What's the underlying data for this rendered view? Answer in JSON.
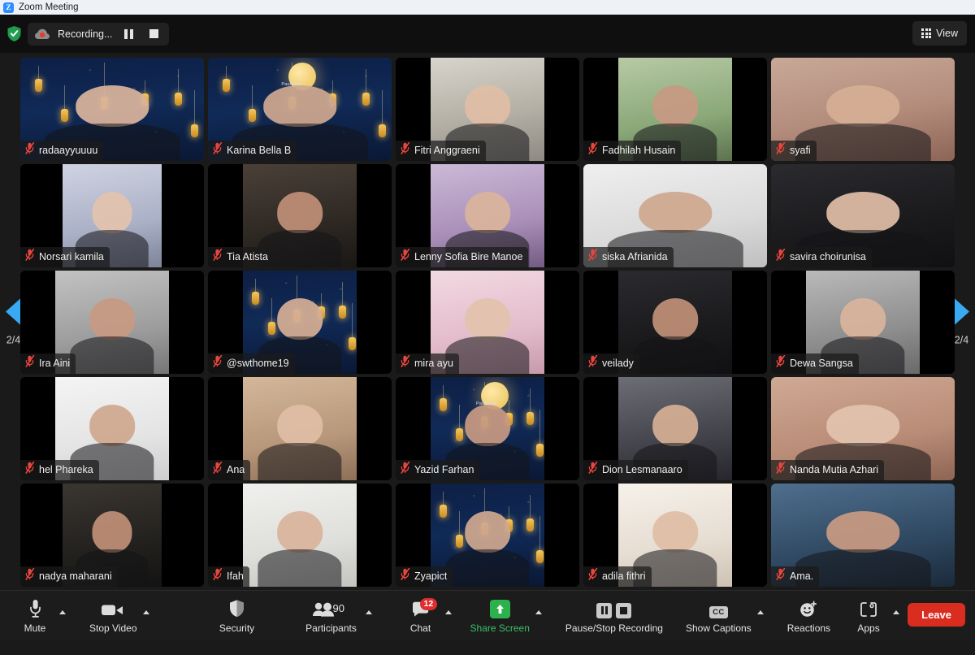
{
  "window": {
    "title": "Zoom Meeting",
    "logo_letter": "Z"
  },
  "topbar": {
    "shield_icon": "security-shield-icon",
    "recording": {
      "label": "Recording...",
      "cloud_icon": "cloud-record-icon",
      "pause_icon": "pause-icon",
      "stop_icon": "stop-icon"
    },
    "view": {
      "label": "View",
      "icon": "grid-view-icon"
    }
  },
  "pager": {
    "left_icon": "previous-page-arrow-icon",
    "right_icon": "next-page-arrow-icon",
    "left_label": "2/4",
    "right_label": "2/4"
  },
  "gallery": {
    "mute_icon": "muted-microphone-icon",
    "participants": [
      {
        "name": "radaayyuuuu",
        "muted": true,
        "fit": "full",
        "bg": "ramadan",
        "speaking": true
      },
      {
        "name": "Karina Bella B",
        "muted": true,
        "fit": "full",
        "bg": "ramadan-moon",
        "speaking": true
      },
      {
        "name": "Fitri Anggraeni",
        "muted": true,
        "fit": "portrait",
        "bg": "room-light"
      },
      {
        "name": "Fadhilah Husain",
        "muted": true,
        "fit": "portrait",
        "bg": "room-green"
      },
      {
        "name": "syafi",
        "muted": true,
        "fit": "full",
        "bg": "room-warm",
        "speaking": true
      },
      {
        "name": "Norsari kamila",
        "muted": true,
        "fit": "portrait-n",
        "bg": "room-curtain"
      },
      {
        "name": "Tia Atista",
        "muted": true,
        "fit": "portrait",
        "bg": "room-dim"
      },
      {
        "name": "Lenny Sofia Bire Manoe",
        "muted": true,
        "fit": "portrait",
        "bg": "room-purple"
      },
      {
        "name": "siska Afrianida",
        "muted": true,
        "fit": "wide",
        "bg": "room-white"
      },
      {
        "name": "savira choirunisa",
        "muted": true,
        "fit": "full",
        "bg": "room-dark"
      },
      {
        "name": "Ira Aini",
        "muted": true,
        "fit": "portrait",
        "bg": "room-grey"
      },
      {
        "name": "@swthome19",
        "muted": true,
        "fit": "portrait",
        "bg": "ramadan"
      },
      {
        "name": "mira ayu",
        "muted": true,
        "fit": "portrait",
        "bg": "room-pink"
      },
      {
        "name": "veilady",
        "muted": true,
        "fit": "portrait",
        "bg": "room-dark"
      },
      {
        "name": "Dewa Sangsa",
        "muted": true,
        "fit": "portrait",
        "bg": "room-grey2"
      },
      {
        "name": "hel Phareka",
        "muted": true,
        "fit": "portrait",
        "bg": "room-white2"
      },
      {
        "name": "Ana",
        "muted": true,
        "fit": "portrait",
        "bg": "room-tan"
      },
      {
        "name": "Yazid Farhan",
        "muted": true,
        "fit": "portrait",
        "bg": "ramadan-moon"
      },
      {
        "name": "Dion Lesmanaaro",
        "muted": true,
        "fit": "portrait",
        "bg": "room-dim2"
      },
      {
        "name": "Nanda Mutia Azhari",
        "muted": true,
        "fit": "full",
        "bg": "room-skin",
        "speaking": true
      },
      {
        "name": "nadya maharani",
        "muted": true,
        "fit": "portrait-n",
        "bg": "room-dark2"
      },
      {
        "name": "Ifah",
        "muted": true,
        "fit": "portrait",
        "bg": "room-white3"
      },
      {
        "name": "Zyapict",
        "muted": true,
        "fit": "portrait",
        "bg": "ramadan"
      },
      {
        "name": "adila fithri",
        "muted": true,
        "fit": "portrait",
        "bg": "room-bright"
      },
      {
        "name": "Ama.",
        "muted": true,
        "fit": "full",
        "bg": "room-blue",
        "speaking": true
      }
    ]
  },
  "toolbar": {
    "mute": {
      "label": "Mute",
      "icon": "microphone-icon",
      "has_caret": true
    },
    "video": {
      "label": "Stop Video",
      "icon": "video-camera-icon",
      "has_caret": true
    },
    "security": {
      "label": "Security",
      "icon": "shield-icon"
    },
    "participants": {
      "label": "Participants",
      "icon": "people-icon",
      "count": "90",
      "has_caret": true
    },
    "chat": {
      "label": "Chat",
      "icon": "chat-bubble-icon",
      "badge": "12",
      "has_caret": true
    },
    "share": {
      "label": "Share Screen",
      "icon": "share-up-arrow-icon",
      "has_caret": true
    },
    "record": {
      "label": "Pause/Stop Recording",
      "pause_icon": "pause-icon",
      "stop_icon": "stop-icon"
    },
    "captions": {
      "label": "Show Captions",
      "icon": "cc-icon",
      "badge_text": "CC",
      "has_caret": true
    },
    "reactions": {
      "label": "Reactions",
      "icon": "smiley-plus-icon"
    },
    "apps": {
      "label": "Apps",
      "icon": "apps-bracket-icon",
      "has_caret": true
    },
    "leave": {
      "label": "Leave"
    }
  },
  "colors": {
    "accent_blue": "#2d8cff",
    "share_green": "#2bb24c",
    "leave_red": "#d92d20",
    "badge_red": "#e02d2d",
    "pager_blue": "#39a9f4"
  }
}
